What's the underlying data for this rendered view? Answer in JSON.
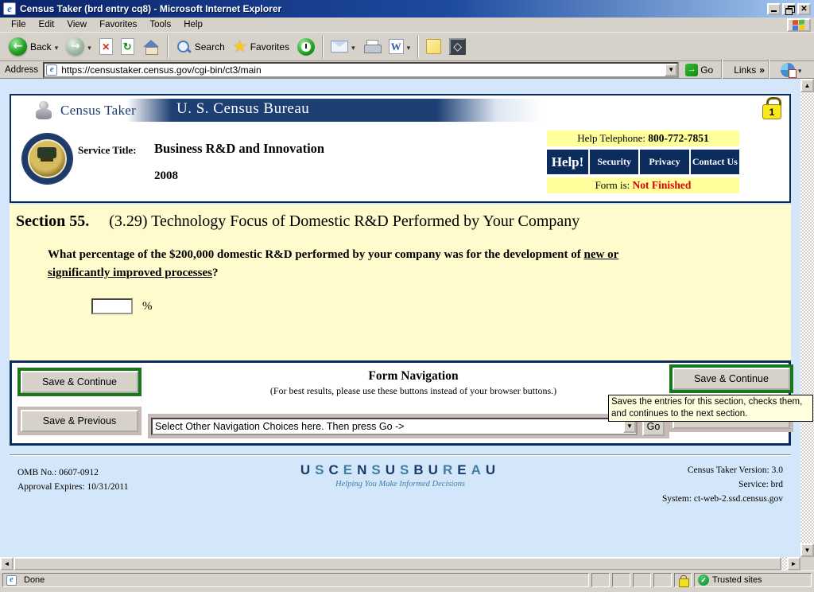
{
  "window": {
    "title": "Census Taker (brd entry cq8) - Microsoft Internet Explorer"
  },
  "menu": {
    "items": [
      "File",
      "Edit",
      "View",
      "Favorites",
      "Tools",
      "Help"
    ]
  },
  "toolbar": {
    "back": "Back",
    "search": "Search",
    "favorites": "Favorites"
  },
  "address": {
    "label": "Address",
    "url": "https://censustaker.census.gov/cgi-bin/ct3/main",
    "go": "Go",
    "links": "Links"
  },
  "header": {
    "brand": "Census Taker",
    "bureau": "U. S. Census Bureau",
    "lock_digit": "1",
    "service_title_label": "Service Title:",
    "service_title": "Business R&D and Innovation",
    "service_year": "2008",
    "help_phone_label": "Help Telephone: ",
    "help_phone": "800-772-7851",
    "buttons": [
      "Help!",
      "Security",
      "Privacy",
      "Contact Us"
    ],
    "form_status_label": "Form is: ",
    "form_status": "Not Finished"
  },
  "section": {
    "number": "Section 55.",
    "title": "(3.29) Technology Focus of Domestic R&D Performed by Your Company",
    "question_main": "What percentage of the $200,000 domestic R&D performed by your company was for the development of ",
    "question_u1": "new or",
    "question_u2": "significantly improved processes",
    "question_suffix": "?",
    "percent_value": "",
    "percent_sign": "%"
  },
  "nav": {
    "title": "Form Navigation",
    "subtitle": "(For best results, please use these buttons instead of your browser buttons.)",
    "save_continue": "Save & Continue",
    "save_previous": "Save & Previous",
    "dropdown_value": "Select Other Navigation Choices here. Then press Go ->",
    "go": "Go",
    "tooltip": "Saves the entries for this section, checks them, and continues to the next section."
  },
  "footer": {
    "omb_line1": "OMB No.: 0607-0912",
    "omb_line2": "Approval Expires: 10/31/2011",
    "logo": "USCENSUSBUREAU",
    "tagline": "Helping You Make Informed Decisions",
    "version": "Census Taker Version: 3.0",
    "service": "Service: brd",
    "system": "System: ct-web-2.ssd.census.gov"
  },
  "statusbar": {
    "status": "Done",
    "zone": "Trusted sites"
  },
  "colors": {
    "accent_navy": "#0c2c5e",
    "banner_navy": "#1d3f74",
    "bright_yellow": "#ffff9c",
    "pale_yellow": "#fffbcc",
    "status_red": "#e00000",
    "green_border": "#17771a",
    "mauve": "#c8b8b8",
    "tooltip_bg": "#ffffe0"
  }
}
